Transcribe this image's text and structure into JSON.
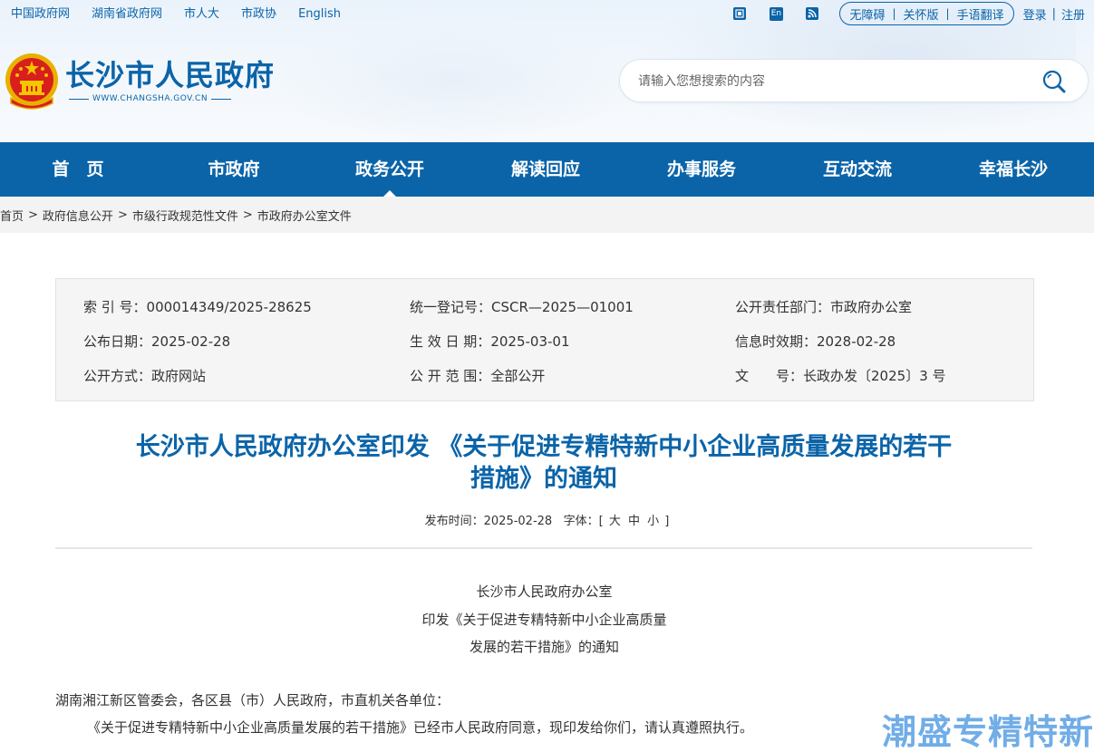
{
  "toplinks": [
    "中国政府网",
    "湖南省政府网",
    "市人大",
    "市政协",
    "English"
  ],
  "topright": {
    "icons": [
      "wechat-icon",
      "english-icon",
      "rss-icon"
    ],
    "en_icon_text": "En",
    "accessibility": "无障碍",
    "care": "关怀版",
    "sign": "手语翻译",
    "login": "登录",
    "register": "注册"
  },
  "logo": {
    "title": "长沙市人民政府",
    "url": "WWW.CHANGSHA.GOV.CN"
  },
  "search": {
    "placeholder": "请输入您想搜索的内容"
  },
  "nav": [
    "首　页",
    "市政府",
    "政务公开",
    "解读回应",
    "办事服务",
    "互动交流",
    "幸福长沙"
  ],
  "breadcrumb": [
    "首页",
    "政府信息公开",
    "市级行政规范性文件",
    "市政府办公室文件"
  ],
  "info": {
    "index_label": "索 引 号：",
    "index_value": "000014349/2025-28625",
    "reg_label": "统一登记号：",
    "reg_value": "CSCR—2025—01001",
    "dept_label": "公开责任部门：",
    "dept_value": "市政府办公室",
    "pub_label": "公布日期：",
    "pub_value": "2025-02-28",
    "eff_label": "生 效 日 期：",
    "eff_value": "2025-03-01",
    "exp_label": "信息时效期：",
    "exp_value": "2028-02-28",
    "way_label": "公开方式：",
    "way_value": "政府网站",
    "scope_label": "公 开 范 围：",
    "scope_value": "全部公开",
    "doc_label": "文　　号：",
    "doc_value": "长政办发〔2025〕3 号"
  },
  "article": {
    "title_line1": "长沙市人民政府办公室印发 《关于促进专精特新中小企业高质量发展的若干",
    "title_line2": "措施》的通知",
    "date_label": "发布时间：",
    "date": "2025-02-28",
    "font_label": "字体：[",
    "font_big": "大",
    "font_mid": "中",
    "font_small": "小",
    "font_end": "]",
    "head1": "长沙市人民政府办公室",
    "head2": "印发《关于促进专精特新中小企业高质量",
    "head3": "发展的若干措施》的通知",
    "recipients": "湖南湘江新区管委会，各区县（市）人民政府，市直机关各单位：",
    "body": "《关于促进专精特新中小企业高质量发展的若干措施》已经市人民政府同意，现印发给你们，请认真遵照执行。"
  },
  "watermark": "潮盛专精特新",
  "colors": {
    "brand": "#0b64a8",
    "nav_bg": "#0b64a8",
    "crumb_bg": "#f3f3f3",
    "infobox_bg": "#f5f5f5"
  }
}
